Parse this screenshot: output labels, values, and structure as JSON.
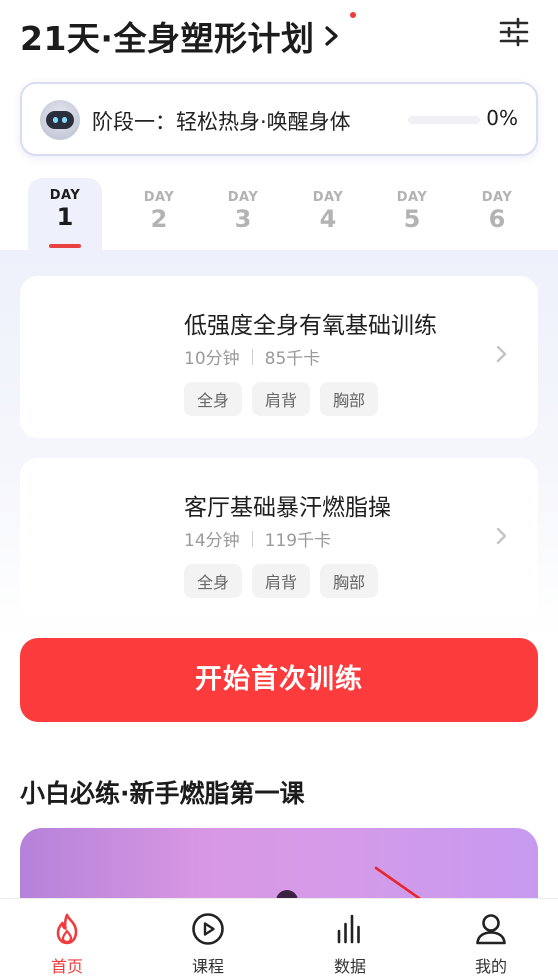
{
  "header": {
    "title": "21天·全身塑形计划"
  },
  "stage": {
    "text": "阶段一：轻松热身·唤醒身体",
    "progress_label": "0%",
    "progress_fraction": 0
  },
  "days": [
    {
      "label": "DAY",
      "num": "1",
      "active": true
    },
    {
      "label": "DAY",
      "num": "2",
      "active": false
    },
    {
      "label": "DAY",
      "num": "3",
      "active": false
    },
    {
      "label": "DAY",
      "num": "4",
      "active": false
    },
    {
      "label": "DAY",
      "num": "5",
      "active": false
    },
    {
      "label": "DAY",
      "num": "6",
      "active": false
    }
  ],
  "workouts": [
    {
      "name": "低强度全身有氧基础训练",
      "duration": "10分钟",
      "calories": "85千卡",
      "tags": [
        "全身",
        "肩背",
        "胸部"
      ]
    },
    {
      "name": "客厅基础暴汗燃脂操",
      "duration": "14分钟",
      "calories": "119千卡",
      "tags": [
        "全身",
        "肩背",
        "胸部"
      ]
    }
  ],
  "start_button": "开始首次训练",
  "section": {
    "title": "小白必练·新手燃脂第一课"
  },
  "nav": [
    {
      "label": "首页",
      "icon": "flame-icon",
      "active": true
    },
    {
      "label": "课程",
      "icon": "play-circle-icon",
      "active": false
    },
    {
      "label": "数据",
      "icon": "bar-chart-icon",
      "active": false
    },
    {
      "label": "我的",
      "icon": "user-icon",
      "active": false
    }
  ],
  "colors": {
    "accent": "#fc3b3c",
    "active_nav": "#f03c3c",
    "tab_bg": "#eef1fb"
  }
}
